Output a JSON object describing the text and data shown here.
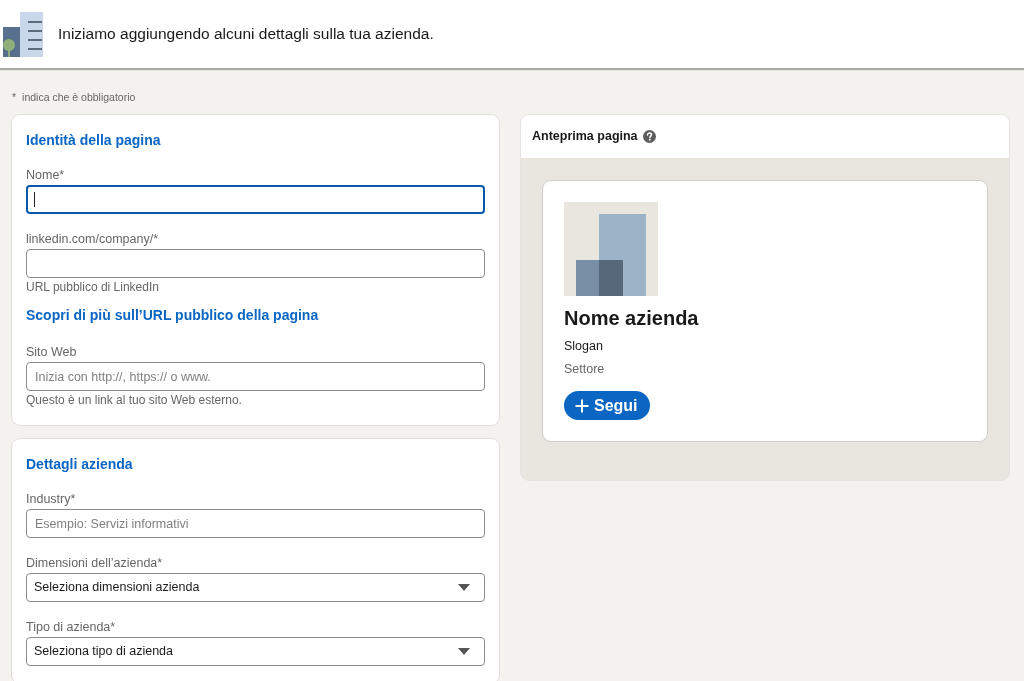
{
  "header": {
    "title": "Iniziamo aggiungendo alcuni dettagli sulla tua azienda."
  },
  "required_note": {
    "marker": "*",
    "text": "indica che è obbligatorio"
  },
  "sections": [
    {
      "title": "Identità della pagina",
      "items": [
        {
          "kind": "input",
          "label": "Nome*",
          "focused": true
        },
        {
          "kind": "input",
          "label": "linkedin.com/company/*",
          "focused": false,
          "helper": "URL pubblico di LinkedIn"
        },
        {
          "kind": "link",
          "text": "Scopri di più sull’URL pubblico della pagina"
        },
        {
          "kind": "input",
          "label": "Sito Web",
          "focused": false,
          "placeholder": "Inizia con http://, https:// o www.",
          "helper": "Questo è un link al tuo sito Web esterno."
        }
      ]
    },
    {
      "title": "Dettagli azienda",
      "items": [
        {
          "kind": "input",
          "label": "Industry*",
          "focused": false,
          "placeholder": "Esempio: Servizi informativi"
        },
        {
          "kind": "select",
          "label": "Dimensioni dell’azienda*",
          "value": "Seleziona dimensioni azienda"
        },
        {
          "kind": "select",
          "label": "Tipo di azienda*",
          "value": "Seleziona tipo di azienda"
        }
      ]
    }
  ],
  "preview": {
    "title": "Anteprima pagina",
    "company_name": "Nome azienda",
    "tagline": "Slogan",
    "industry": "Settore",
    "follow_button": "Segui"
  }
}
